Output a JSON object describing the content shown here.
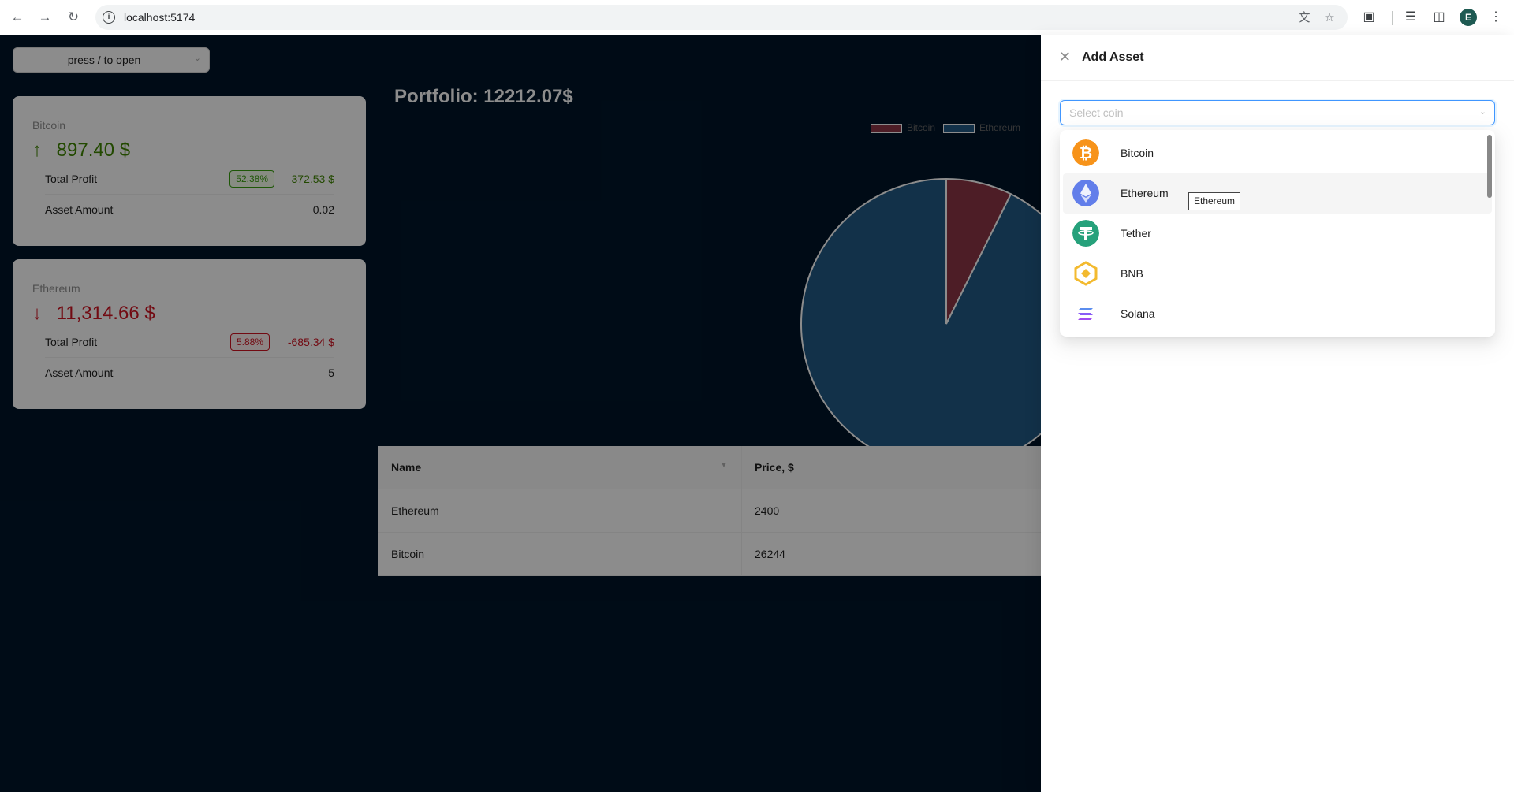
{
  "browser": {
    "url": "localhost:5174",
    "profile_initial": "E"
  },
  "header": {
    "select_placeholder": "press / to open"
  },
  "cards": [
    {
      "title": "Bitcoin",
      "trend": "up",
      "value": "897.40 $",
      "profit_label": "Total Profit",
      "profit_percent": "52.38%",
      "profit_value": "372.53 $",
      "amount_label": "Asset Amount",
      "amount_value": "0.02"
    },
    {
      "title": "Ethereum",
      "trend": "down",
      "value": "11,314.66 $",
      "profit_label": "Total Profit",
      "profit_percent": "5.88%",
      "profit_value": "-685.34 $",
      "amount_label": "Asset Amount",
      "amount_value": "5"
    }
  ],
  "portfolio": {
    "title": "Portfolio: 12212.07$"
  },
  "chart_data": {
    "type": "pie",
    "title": "",
    "categories": [
      "Bitcoin",
      "Ethereum"
    ],
    "values": [
      897.4,
      11314.66
    ],
    "colors": [
      "#8c3545",
      "#215a85"
    ],
    "legend_position": "top"
  },
  "table": {
    "columns": [
      "Name",
      "Price, $"
    ],
    "rows": [
      [
        "Ethereum",
        "2400"
      ],
      [
        "Bitcoin",
        "26244"
      ]
    ]
  },
  "drawer": {
    "title": "Add Asset",
    "select_placeholder": "Select coin",
    "options": [
      {
        "name": "Bitcoin",
        "icon": "bitcoin-icon",
        "color": "#f7931a"
      },
      {
        "name": "Ethereum",
        "icon": "ethereum-icon",
        "color": "#627eea"
      },
      {
        "name": "Tether",
        "icon": "tether-icon",
        "color": "#26a17b"
      },
      {
        "name": "BNB",
        "icon": "bnb-icon",
        "color": "#f3ba2f"
      },
      {
        "name": "Solana",
        "icon": "solana-icon",
        "color": "#9945ff"
      }
    ],
    "tooltip": "Ethereum"
  }
}
